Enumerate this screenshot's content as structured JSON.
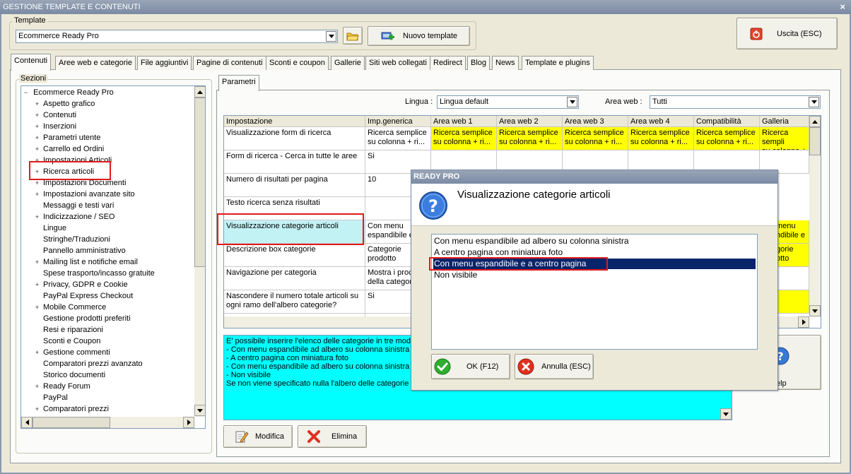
{
  "window": {
    "title": "GESTIONE TEMPLATE E CONTENUTI",
    "close_glyph": "×"
  },
  "template_group": {
    "legend": "Template",
    "selected_template": "Ecommerce Ready Pro",
    "new_template_label": "Nuovo template"
  },
  "exit_button_label": "Uscita (ESC)",
  "tabs": [
    {
      "label": "Contenuti",
      "active": true
    },
    {
      "label": "Aree web e categorie"
    },
    {
      "label": "File aggiuntivi"
    },
    {
      "label": "Pagine di contenuti"
    },
    {
      "label": "Sconti e coupon"
    },
    {
      "label": "Gallerie"
    },
    {
      "label": "Siti web collegati"
    },
    {
      "label": "Redirect"
    },
    {
      "label": "Blog"
    },
    {
      "label": "News"
    },
    {
      "label": "Template e plugins"
    }
  ],
  "sections": {
    "legend": "Sezioni",
    "root": "Ecommerce Ready Pro",
    "items": [
      {
        "label": "Aspetto grafico",
        "expandable": true
      },
      {
        "label": "Contenuti",
        "expandable": true
      },
      {
        "label": "Inserzioni",
        "expandable": true
      },
      {
        "label": "Parametri utente",
        "expandable": true
      },
      {
        "label": "Carrello ed Ordini",
        "expandable": true
      },
      {
        "label": "Impostazioni Articoli",
        "expandable": true
      },
      {
        "label": "Ricerca articoli",
        "expandable": true,
        "highlighted": true
      },
      {
        "label": "Impostazioni Documenti",
        "expandable": true
      },
      {
        "label": "Impostazioni avanzate sito",
        "expandable": true
      },
      {
        "label": "Messaggi e testi vari",
        "expandable": false
      },
      {
        "label": "Indicizzazione / SEO",
        "expandable": true
      },
      {
        "label": "Lingue",
        "expandable": false
      },
      {
        "label": "Stringhe/Traduzioni",
        "expandable": false
      },
      {
        "label": "Pannello amministrativo",
        "expandable": false
      },
      {
        "label": "Mailing list e notifiche email",
        "expandable": true
      },
      {
        "label": "Spese trasporto/incasso gratuite",
        "expandable": false
      },
      {
        "label": "Privacy, GDPR e Cookie",
        "expandable": true
      },
      {
        "label": "PayPal Express Checkout",
        "expandable": false
      },
      {
        "label": "Mobile Commerce",
        "expandable": true
      },
      {
        "label": "Gestione prodotti preferiti",
        "expandable": false
      },
      {
        "label": "Resi e riparazioni",
        "expandable": false
      },
      {
        "label": "Sconti e Coupon",
        "expandable": false
      },
      {
        "label": "Gestione commenti",
        "expandable": true
      },
      {
        "label": "Comparatori prezzi avanzato",
        "expandable": false
      },
      {
        "label": "Storico documenti",
        "expandable": false
      },
      {
        "label": "Ready Forum",
        "expandable": true
      },
      {
        "label": "PayPal",
        "expandable": false
      },
      {
        "label": "Comparatori prezzi",
        "expandable": true
      }
    ]
  },
  "params": {
    "tab_label": "Parametri",
    "lingua_label": "Lingua :",
    "lingua_value": "Lingua default",
    "area_label": "Area web :",
    "area_value": "Tutti",
    "columns": [
      "Impostazione",
      "Imp.generica",
      "Area web 1",
      "Area web 2",
      "Area web 3",
      "Area web 4",
      "Compatibilità",
      "Galleria"
    ],
    "rows": [
      {
        "setting": "Visualizzazione form di ricerca",
        "generic": "Ricerca semplice\nsu colonna + ri...",
        "areas": [
          "Ricerca semplice\nsu colonna + ri...",
          "Ricerca semplice\nsu colonna + ri...",
          "Ricerca semplice\nsu colonna + ri...",
          "Ricerca semplice\nsu colonna + ri...",
          "Ricerca semplice\nsu colonna + ri...",
          "Ricerca sempli\nsu colonna + ri"
        ]
      },
      {
        "setting": "Form di ricerca - Cerca in tutte le aree",
        "generic": "Si",
        "areas": []
      },
      {
        "setting": "Numero di risultati per pagina",
        "generic": "10",
        "areas": []
      },
      {
        "setting": "Testo ricerca senza risultati",
        "generic": "",
        "areas": []
      },
      {
        "setting": "Visualizzazione categorie articoli",
        "generic": "Con menu\nespandibile e",
        "galleria": "menu\nndibile e",
        "selected": true
      },
      {
        "setting": "Descrizione box categorie",
        "generic": "Categorie\nprodotto",
        "galleria": "gorie\notto"
      },
      {
        "setting": "Navigazione per categoria",
        "generic": "Mostra i proc\ndella categor",
        "galleria": ""
      },
      {
        "setting": "Nascondere il numero totale articoli su\nogni ramo dell'albero categorie?",
        "generic": "Si",
        "galleria": ""
      }
    ],
    "description": "E' possibile inserire l'elenco delle categorie in tre modali\n- Con menu espandibile ad albero su colonna sinistra\n- A centro pagina con miniatura foto\n- Con menu espandibile ad albero su colonna sinistra e\n- Non visibile\nSe non viene specificato nulla l'albero delle categorie vi",
    "help_label": "elp",
    "modify_label": "Modifica",
    "delete_label": "Elimina"
  },
  "dialog": {
    "title": "READY PRO",
    "heading": "Visualizzazione categorie articoli",
    "options": [
      "Con menu espandibile ad albero su colonna sinistra",
      "A centro pagina con miniatura foto",
      "Con menu espandibile e a centro pagina",
      "Non visibile"
    ],
    "selected_index": 2,
    "ok_label": "OK (F12)",
    "cancel_label": "Annulla (ESC)"
  },
  "colors": {
    "highlight_yellow": "#ffff00",
    "selection_cyan": "#c3f2f5",
    "description_cyan": "#00ffff",
    "annotation_red": "#e01b1b",
    "list_selection": "#0a246a"
  }
}
